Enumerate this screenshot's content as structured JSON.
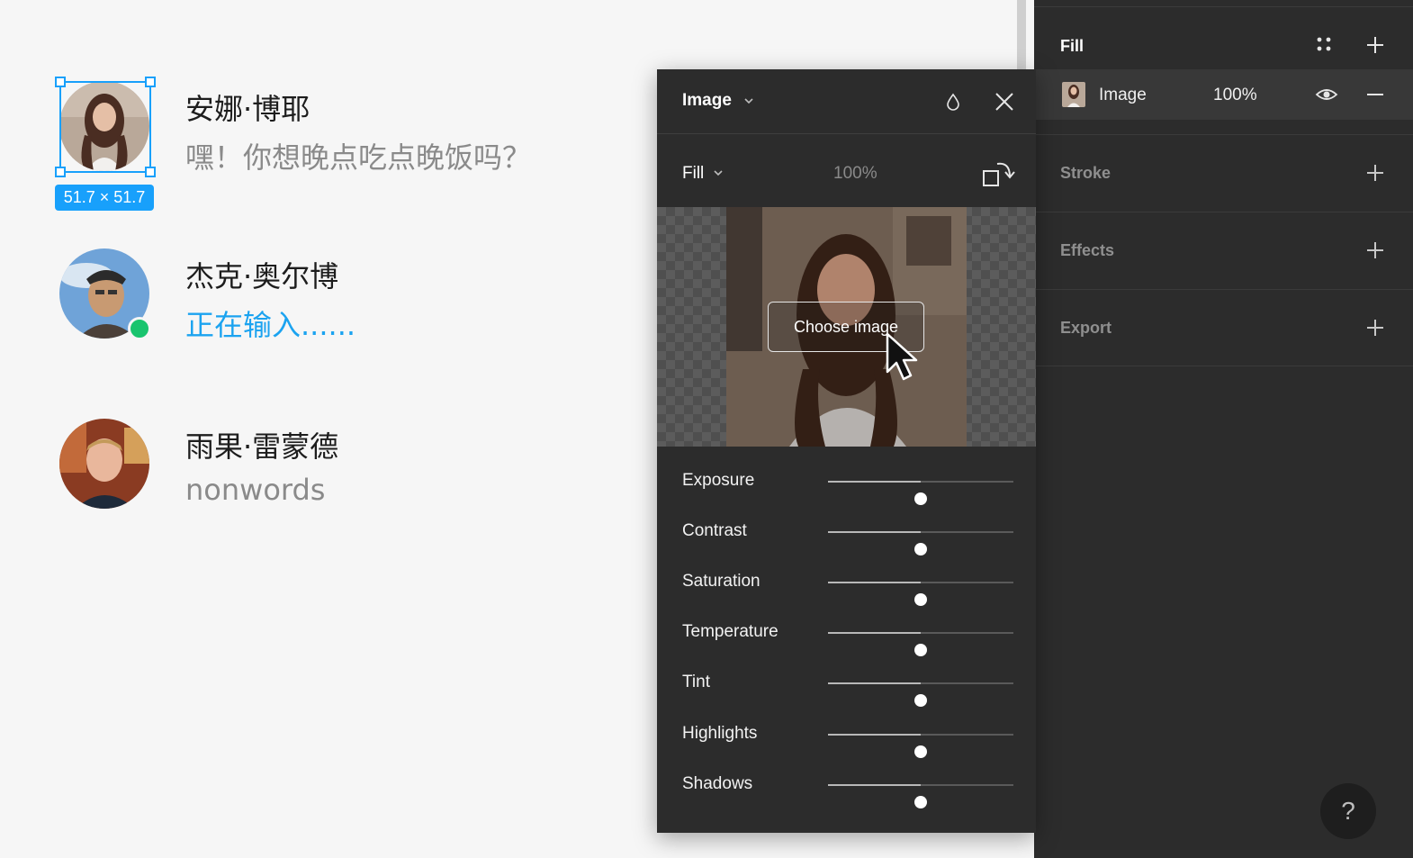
{
  "canvas": {
    "selection_size": "51.7 × 51.7",
    "chats": [
      {
        "name": "安娜·博耶",
        "message": "嘿！你想晚点吃点晚饭吗？",
        "typing": false,
        "online": false
      },
      {
        "name": "杰克·奥尔博",
        "message": "正在输入......",
        "typing": true,
        "online": true
      },
      {
        "name": "雨果·雷蒙德",
        "message": "nonwords",
        "typing": false,
        "online": false
      }
    ]
  },
  "image_popover": {
    "title": "Image",
    "fill_mode": "Fill",
    "opacity": "100%",
    "choose_image_label": "Choose image",
    "adjustments": [
      {
        "label": "Exposure",
        "value": 0
      },
      {
        "label": "Contrast",
        "value": 0
      },
      {
        "label": "Saturation",
        "value": 0
      },
      {
        "label": "Temperature",
        "value": 0
      },
      {
        "label": "Tint",
        "value": 0
      },
      {
        "label": "Highlights",
        "value": 0
      },
      {
        "label": "Shadows",
        "value": 0
      }
    ]
  },
  "properties_panel": {
    "fill": {
      "title": "Fill",
      "layer_type": "Image",
      "layer_opacity": "100%"
    },
    "stroke_title": "Stroke",
    "effects_title": "Effects",
    "export_title": "Export",
    "help_label": "?"
  },
  "colors": {
    "accent": "#18a0fb",
    "online": "#19c46e",
    "typing": "#1ba3f0",
    "panel_bg": "#2c2c2c"
  }
}
